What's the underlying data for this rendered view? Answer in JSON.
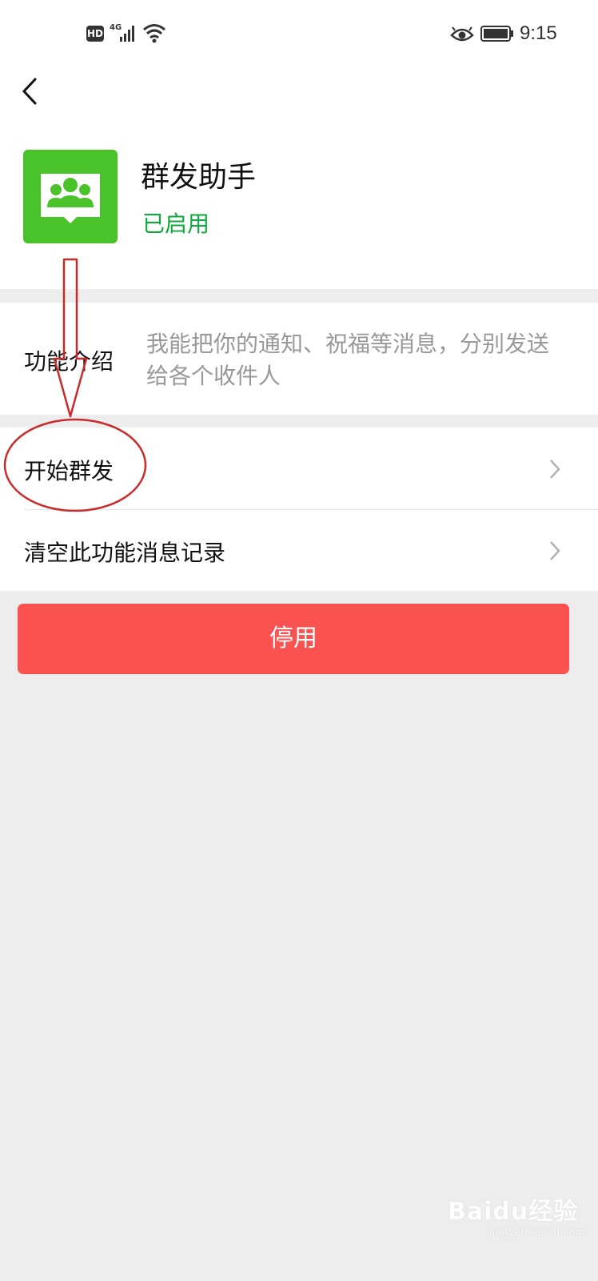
{
  "status_bar": {
    "hd_badge": "HD",
    "network": "4G",
    "time": "9:15",
    "icons": [
      "signal-icon",
      "wifi-icon",
      "eye-icon",
      "battery-icon"
    ]
  },
  "nav": {
    "back_icon": "back-chevron-icon"
  },
  "app": {
    "name": "群发助手",
    "status": "已启用",
    "icon": "group-message-icon",
    "brand_color": "#4ac22a",
    "status_color": "#10a93e"
  },
  "intro": {
    "label": "功能介绍",
    "text": "我能把你的通知、祝福等消息，分别发送给各个收件人"
  },
  "menu": {
    "items": [
      {
        "label": "开始群发",
        "icon": "chevron-right-icon"
      },
      {
        "label": "清空此功能消息记录",
        "icon": "chevron-right-icon"
      }
    ]
  },
  "action": {
    "disable_label": "停用",
    "color": "#fa5151"
  },
  "annotation": {
    "color": "#cc2a2a",
    "shapes": [
      "down-arrow",
      "ellipse"
    ]
  },
  "watermark": {
    "text": "Baidu经验",
    "url": "jingyan.baidu.com"
  }
}
